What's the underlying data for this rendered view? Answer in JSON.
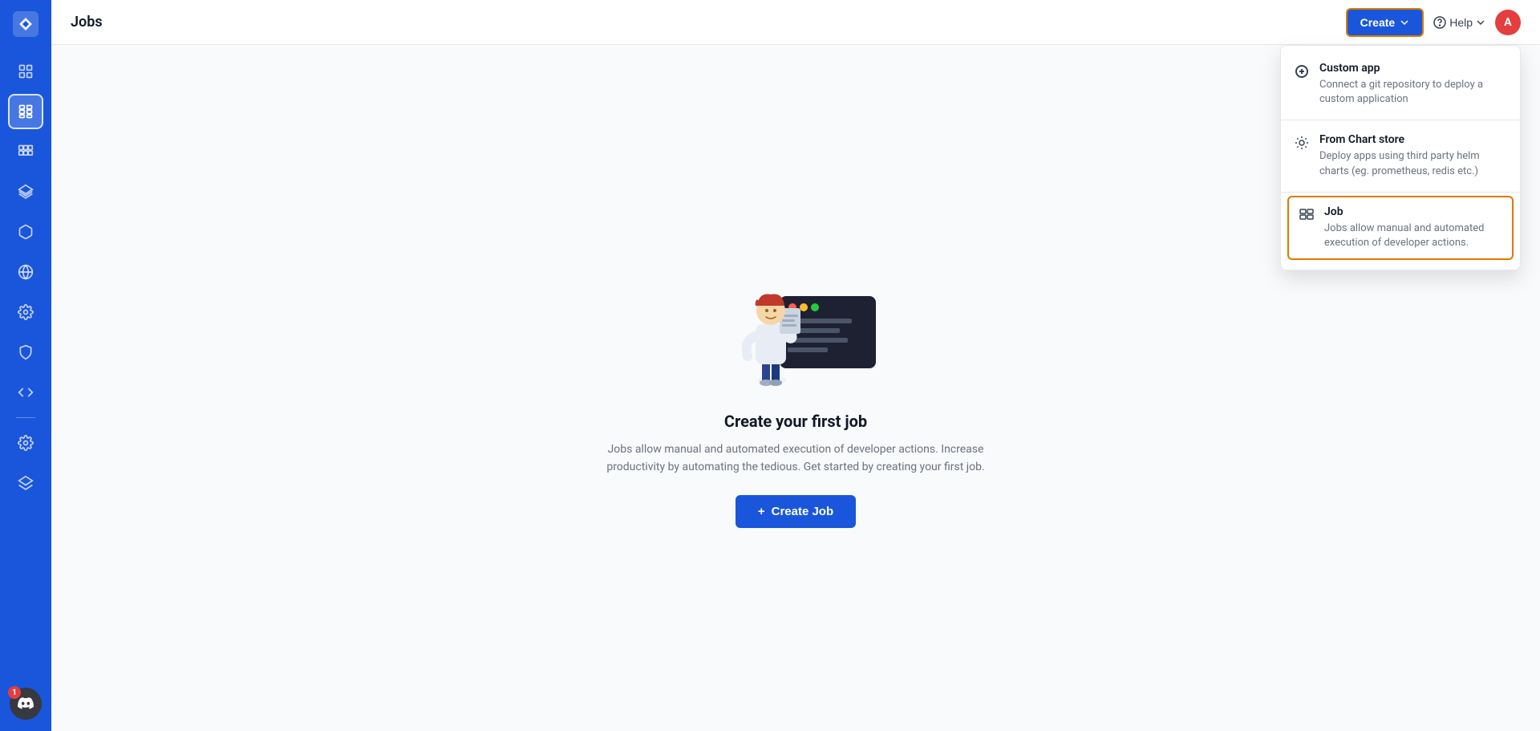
{
  "app": {
    "title": "Jobs"
  },
  "header": {
    "create_label": "Create",
    "help_label": "Help",
    "avatar_label": "A"
  },
  "sidebar": {
    "items": [
      {
        "id": "home",
        "icon": "grid-icon"
      },
      {
        "id": "jobs",
        "icon": "table-icon",
        "active": true
      },
      {
        "id": "pipelines",
        "icon": "layout-icon"
      },
      {
        "id": "layers",
        "icon": "layers-icon"
      },
      {
        "id": "cube",
        "icon": "cube-icon"
      },
      {
        "id": "globe",
        "icon": "globe-icon"
      },
      {
        "id": "gear",
        "icon": "gear-icon"
      },
      {
        "id": "shield",
        "icon": "shield-icon"
      },
      {
        "id": "code",
        "icon": "code-icon"
      },
      {
        "id": "settings",
        "icon": "settings-icon"
      },
      {
        "id": "stack",
        "icon": "stack-icon"
      }
    ],
    "discord_badge": "1"
  },
  "empty_state": {
    "title": "Create your first job",
    "description": "Jobs allow manual and automated execution of developer actions. Increase productivity by automating the tedious. Get started by creating your first job.",
    "button_label": "Create Job"
  },
  "dropdown": {
    "items": [
      {
        "id": "custom-app",
        "title": "Custom app",
        "description": "Connect a git repository to deploy a custom application",
        "icon": "plus-icon",
        "highlighted": false
      },
      {
        "id": "chart-store",
        "title": "From Chart store",
        "description": "Deploy apps using third party helm charts (eg. prometheus, redis etc.)",
        "icon": "gear-icon",
        "highlighted": false
      },
      {
        "id": "job",
        "title": "Job",
        "description": "Jobs allow manual and automated execution of developer actions.",
        "icon": "table-icon",
        "highlighted": true
      }
    ]
  },
  "colors": {
    "primary": "#1a56db",
    "accent": "#e07900"
  }
}
